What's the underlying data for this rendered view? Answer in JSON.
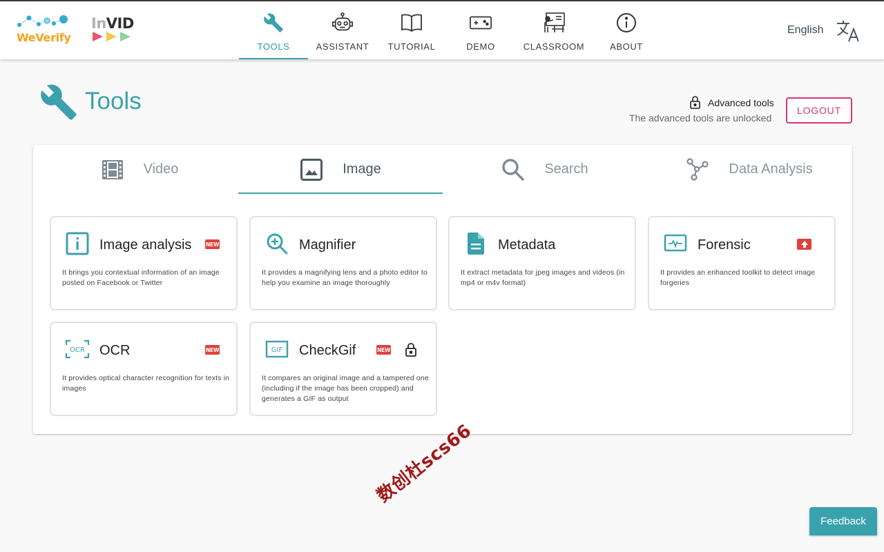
{
  "colors": {
    "accent": "#3ba1ad",
    "logout": "#d9366a",
    "badge_red": "#e0403a",
    "weverify_orange": "#f5a31a"
  },
  "logos": {
    "weverify": "WeVerify",
    "invid_in": "In",
    "invid_vid": "VID"
  },
  "nav": {
    "items": [
      {
        "label": "TOOLS",
        "icon": "wrench-icon",
        "active": true
      },
      {
        "label": "ASSISTANT",
        "icon": "robot-icon"
      },
      {
        "label": "TUTORIAL",
        "icon": "book-icon"
      },
      {
        "label": "DEMO",
        "icon": "gamepad-icon"
      },
      {
        "label": "CLASSROOM",
        "icon": "classroom-icon"
      },
      {
        "label": "ABOUT",
        "icon": "info-icon"
      }
    ],
    "language": "English",
    "language_icon": "translate-icon"
  },
  "page": {
    "title": "Tools",
    "advanced_label": "Advanced tools",
    "advanced_status": "The advanced tools are unlocked",
    "logout": "LOGOUT"
  },
  "tabs": [
    {
      "label": "Video",
      "icon": "film-icon"
    },
    {
      "label": "Image",
      "icon": "image-icon",
      "active": true
    },
    {
      "label": "Search",
      "icon": "search-icon"
    },
    {
      "label": "Data Analysis",
      "icon": "graph-icon"
    }
  ],
  "tools": [
    {
      "title": "Image analysis",
      "desc": "It brings you contextual information of an image posted on Facebook or Twitter",
      "icon": "info-box-icon",
      "badge": "NEW"
    },
    {
      "title": "Magnifier",
      "desc": "It provides a magnifying lens and a photo editor to help you examine an image thoroughly",
      "icon": "zoom-in-icon"
    },
    {
      "title": "Metadata",
      "desc": "It extract metadata for jpeg images and videos (in mp4 or m4v format)",
      "icon": "document-icon"
    },
    {
      "title": "Forensic",
      "desc": "It provides an enhanced toolkit to detect image forgeries",
      "icon": "monitor-pulse-icon",
      "badge": "upgrade"
    },
    {
      "title": "OCR",
      "desc": "It provides optical character recognition for texts in images",
      "icon": "ocr-icon",
      "badge": "NEW",
      "icon_text": "OCR"
    },
    {
      "title": "CheckGif",
      "desc": "It compares an original image and a tampered one (including if the image has been cropped) and generates a GIF as output",
      "icon": "gif-icon",
      "badge": "NEW",
      "icon_text": "GIF",
      "locked": true
    }
  ],
  "watermark": "数创杜scs66",
  "feedback": "Feedback"
}
